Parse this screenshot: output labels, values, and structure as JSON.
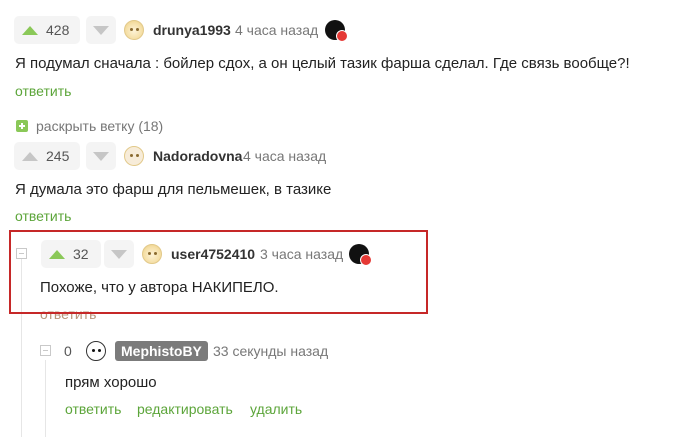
{
  "comments": [
    {
      "rating": "428",
      "username": "drunya1993",
      "time": "4 часа назад",
      "text": "Я подумал сначала : бойлер сдох, а он целый тазик фарша сделал. Где связь вообще?!",
      "reply": "ответить"
    },
    {
      "expand_label": "раскрыть ветку (18)"
    },
    {
      "rating": "245",
      "username": "Nadoradovna",
      "time": "4 часа назад",
      "text": "Я думала это фарш для пельмешек, в тазике",
      "reply": "ответить"
    },
    {
      "rating": "32",
      "username": "user4752410",
      "time": "3 часа назад",
      "text": "Похоже, что у автора НАКИПЕЛО.",
      "reply": "ответить"
    },
    {
      "rating": "0",
      "username": "MephistoBY",
      "time": "33 секунды назад",
      "text": "прям хорошо",
      "reply": "ответить",
      "edit": "редактировать",
      "delete": "удалить"
    }
  ]
}
